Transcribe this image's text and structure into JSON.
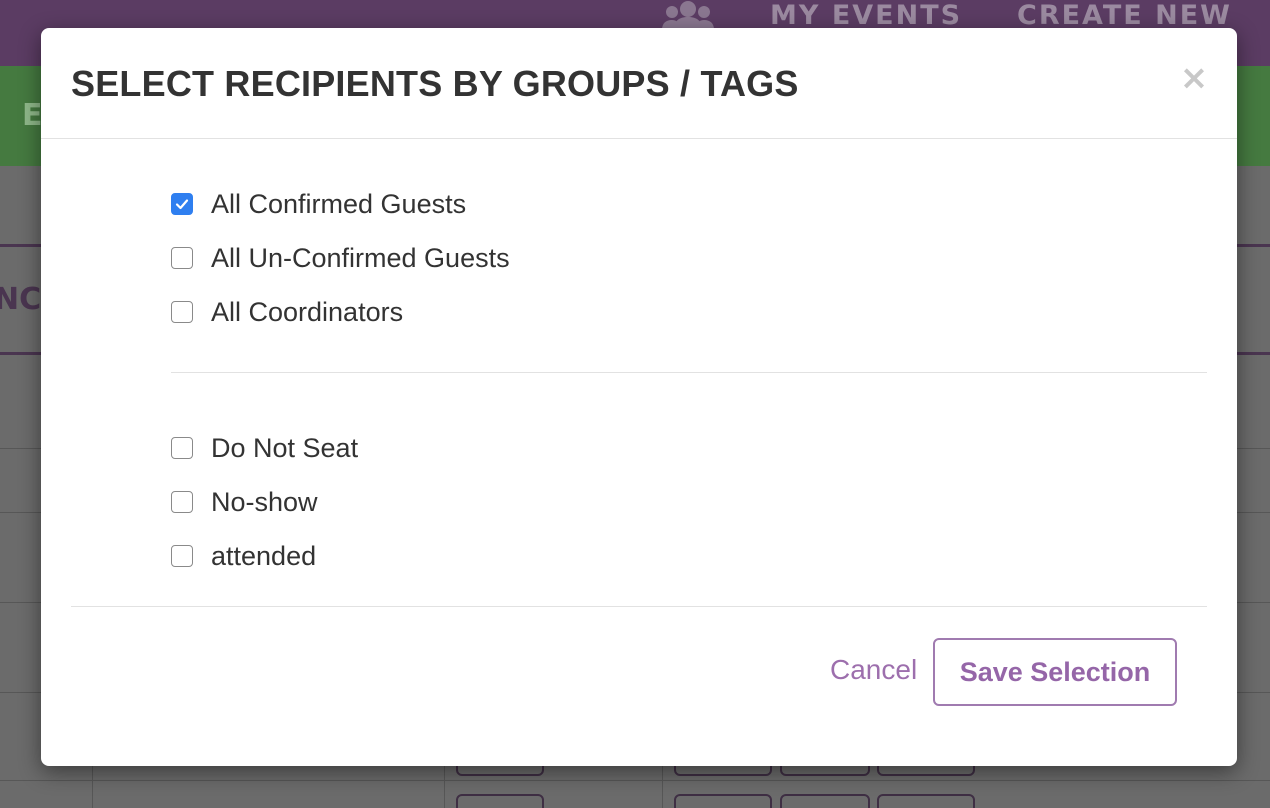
{
  "background": {
    "nav_links": [
      "MY EVENTS",
      "CREATE NEW"
    ],
    "green_bar_text": "E",
    "header_fragment": "NCI"
  },
  "modal": {
    "title": "SELECT RECIPIENTS BY GROUPS / TAGS",
    "close_symbol": "×",
    "groups": [
      {
        "label": "All Confirmed Guests",
        "checked": true
      },
      {
        "label": "All Un-Confirmed Guests",
        "checked": false
      },
      {
        "label": "All Coordinators",
        "checked": false
      }
    ],
    "tags": [
      {
        "label": "Do Not Seat",
        "checked": false
      },
      {
        "label": "No-show",
        "checked": false
      },
      {
        "label": "attended",
        "checked": false
      }
    ],
    "cancel_label": "Cancel",
    "save_label": "Save Selection"
  },
  "colors": {
    "nav_purple": "#5b3c63",
    "accent_purple": "#9566a8",
    "checkbox_blue": "#2f7ff0",
    "green_bar": "#457a40"
  },
  "icons": {
    "nav_icon": "users-icon",
    "checked_icon": "checkmark-icon",
    "close_icon": "close-icon"
  }
}
